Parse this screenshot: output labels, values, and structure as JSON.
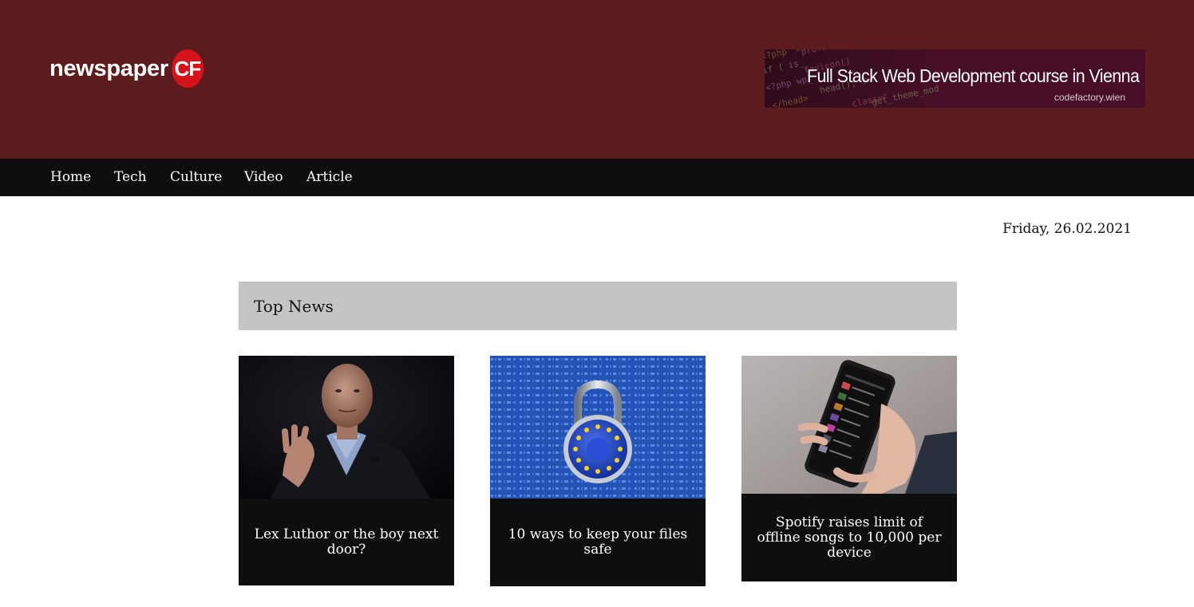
{
  "logo": {
    "word": "newspaper",
    "badge": "CF"
  },
  "banner": {
    "headline": "Full Stack Web Development course in Vienna",
    "subtext": "codefactory.wien"
  },
  "nav": {
    "items": [
      {
        "label": "Home"
      },
      {
        "label": "Tech"
      },
      {
        "label": "Culture"
      },
      {
        "label": "Video"
      },
      {
        "label": "Article"
      }
    ]
  },
  "date": "Friday, 26.02.2021",
  "section": {
    "title": "Top News"
  },
  "cards": [
    {
      "title": "Lex Luthor or the boy next door?",
      "image_icon": "portrait-photo"
    },
    {
      "title": "10 ways to keep your files safe",
      "image_icon": "padlock-photo"
    },
    {
      "title": "Spotify raises limit of offline songs to 10,000 per device",
      "image_icon": "phone-photo"
    }
  ],
  "colors": {
    "header_bg": "#5c1b1d",
    "nav_bg": "#0e0e0e",
    "badge_red": "#d6121b",
    "section_bar": "#c4c4c4",
    "caption_bg": "#0e0e0e"
  }
}
